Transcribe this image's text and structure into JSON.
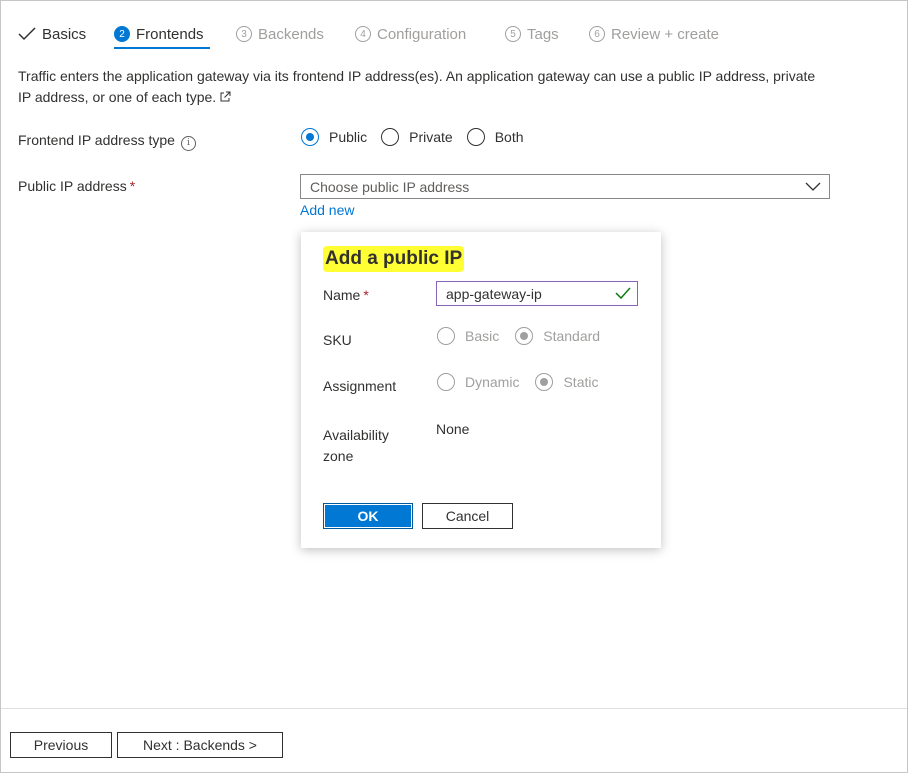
{
  "tabs": [
    {
      "num": "",
      "label": "Basics"
    },
    {
      "num": "2",
      "label": "Frontends"
    },
    {
      "num": "3",
      "label": "Backends"
    },
    {
      "num": "4",
      "label": "Configuration"
    },
    {
      "num": "5",
      "label": "Tags"
    },
    {
      "num": "6",
      "label": "Review + create"
    }
  ],
  "description": "Traffic enters the application gateway via its frontend IP address(es). An application gateway can use a public IP address, private IP address, or one of each type.",
  "frontend_type": {
    "label": "Frontend IP address type",
    "options": [
      "Public",
      "Private",
      "Both"
    ],
    "selected": "Public"
  },
  "public_ip": {
    "label": "Public IP address",
    "required_mark": "*",
    "placeholder": "Choose public IP address",
    "add_new": "Add new"
  },
  "callout": {
    "title": "Add a public IP",
    "name_label": "Name",
    "name_value": "app-gateway-ip",
    "sku_label": "SKU",
    "sku_options": [
      "Basic",
      "Standard"
    ],
    "sku_selected": "Standard",
    "assignment_label": "Assignment",
    "assignment_options": [
      "Dynamic",
      "Static"
    ],
    "assignment_selected": "Static",
    "zone_label_1": "Availability",
    "zone_label_2": "zone",
    "zone_value": "None",
    "ok": "OK",
    "cancel": "Cancel"
  },
  "footer": {
    "previous": "Previous",
    "next": "Next : Backends >"
  },
  "colors": {
    "accent": "#0078d4",
    "highlight": "#ffff33",
    "required": "#a4262c"
  }
}
